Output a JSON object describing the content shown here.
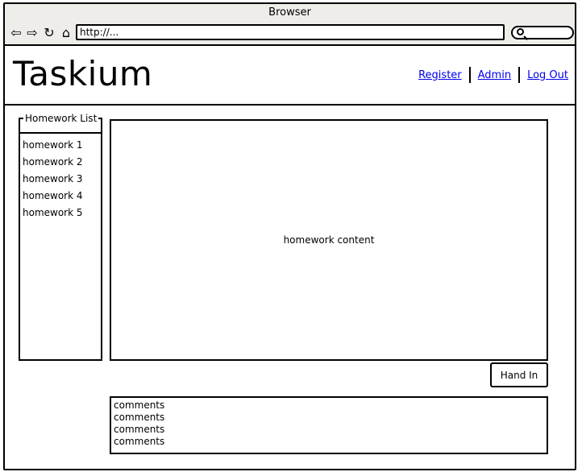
{
  "window": {
    "title": "Browser"
  },
  "toolbar": {
    "icons": [
      "back-icon",
      "forward-icon",
      "reload-icon",
      "home-icon"
    ],
    "url": "http://..."
  },
  "header": {
    "logo": "Taskium",
    "links": [
      "Register",
      "Admin",
      "Log Out"
    ]
  },
  "homework_list": {
    "title": "Homework List",
    "items": [
      "homework 1",
      "homework 2",
      "homework 3",
      "homework 4",
      "homework 5"
    ]
  },
  "content": {
    "text": "homework content"
  },
  "actions": {
    "hand_in_label": "Hand In"
  },
  "comments": [
    "comments",
    "comments",
    "comments",
    "comments"
  ],
  "colors": {
    "chrome": "#efedea",
    "link": "#0000ee"
  }
}
